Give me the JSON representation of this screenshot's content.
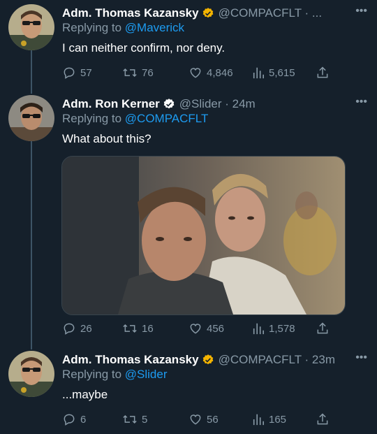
{
  "tweets": [
    {
      "name": "Adm. Thomas Kazansky",
      "handle": "@COMPACFLT · ...",
      "reply_prefix": "Replying to ",
      "reply_to": "@Maverick",
      "text": "I can neither confirm, nor deny.",
      "replies": "57",
      "retweets": "76",
      "likes": "4,846",
      "views": "5,615",
      "badge_color": "#f4b400"
    },
    {
      "name": "Adm. Ron Kerner",
      "handle": "@Slider · 24m",
      "reply_prefix": "Replying to ",
      "reply_to": "@COMPACFLT",
      "text": "What about this?",
      "replies": "26",
      "retweets": "16",
      "likes": "456",
      "views": "1,578",
      "badge_color": "#ffffff"
    },
    {
      "name": "Adm. Thomas Kazansky",
      "handle": "@COMPACFLT · 23m",
      "reply_prefix": "Replying to ",
      "reply_to": "@Slider",
      "text": "...maybe",
      "replies": "6",
      "retweets": "5",
      "likes": "56",
      "views": "165",
      "badge_color": "#f4b400"
    }
  ],
  "icons": {
    "reply": "reply-icon",
    "retweet": "retweet-icon",
    "like": "heart-icon",
    "views": "views-icon",
    "share": "share-icon",
    "more": "more-icon"
  },
  "colors": {
    "background": "#15202b",
    "secondary_text": "#8899a6",
    "mention": "#1d9bf0",
    "thread_line": "#3d5466"
  }
}
